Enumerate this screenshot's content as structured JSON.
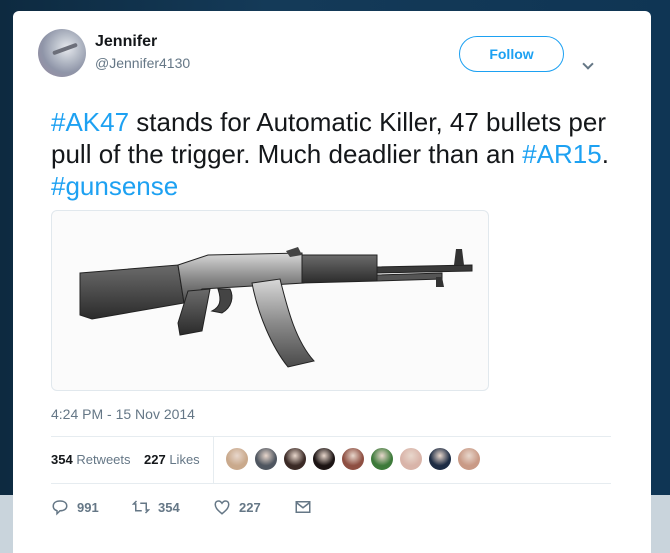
{
  "tweet": {
    "display_name": "Jennifer",
    "handle": "@Jennifer4130",
    "follow_label": "Follow",
    "text_segments": [
      {
        "text": "#AK47",
        "hashtag": true
      },
      {
        "text": " stands for Automatic Killer, 47 bullets per pull of the trigger. Much deadlier than an ",
        "hashtag": false
      },
      {
        "text": "#AR15",
        "hashtag": true
      },
      {
        "text": ". ",
        "hashtag": false
      },
      {
        "text": "#gunsense",
        "hashtag": true
      }
    ],
    "timestamp": "4:24 PM - 15 Nov 2014",
    "retweets_count": "354",
    "retweets_label": "Retweets",
    "likes_count": "227",
    "likes_label": "Likes",
    "actions": {
      "reply_count": "991",
      "retweet_count": "354",
      "like_count": "227"
    }
  },
  "likers": [
    {
      "color": "#c9a98c",
      "icon": "avatar"
    },
    {
      "color": "#4f5660",
      "icon": "avatar"
    },
    {
      "color": "#3b2a26",
      "icon": "avatar"
    },
    {
      "color": "#1c1414",
      "icon": "avatar"
    },
    {
      "color": "#8e4f42",
      "icon": "avatar"
    },
    {
      "color": "#3d7a3a",
      "icon": "avatar"
    },
    {
      "color": "#d9b4a9",
      "icon": "avatar"
    },
    {
      "color": "#1d2c44",
      "icon": "avatar"
    },
    {
      "color": "#c99a86",
      "icon": "avatar"
    }
  ],
  "colors": {
    "link": "#1da1f2",
    "text": "#14171a",
    "muted": "#657786"
  }
}
